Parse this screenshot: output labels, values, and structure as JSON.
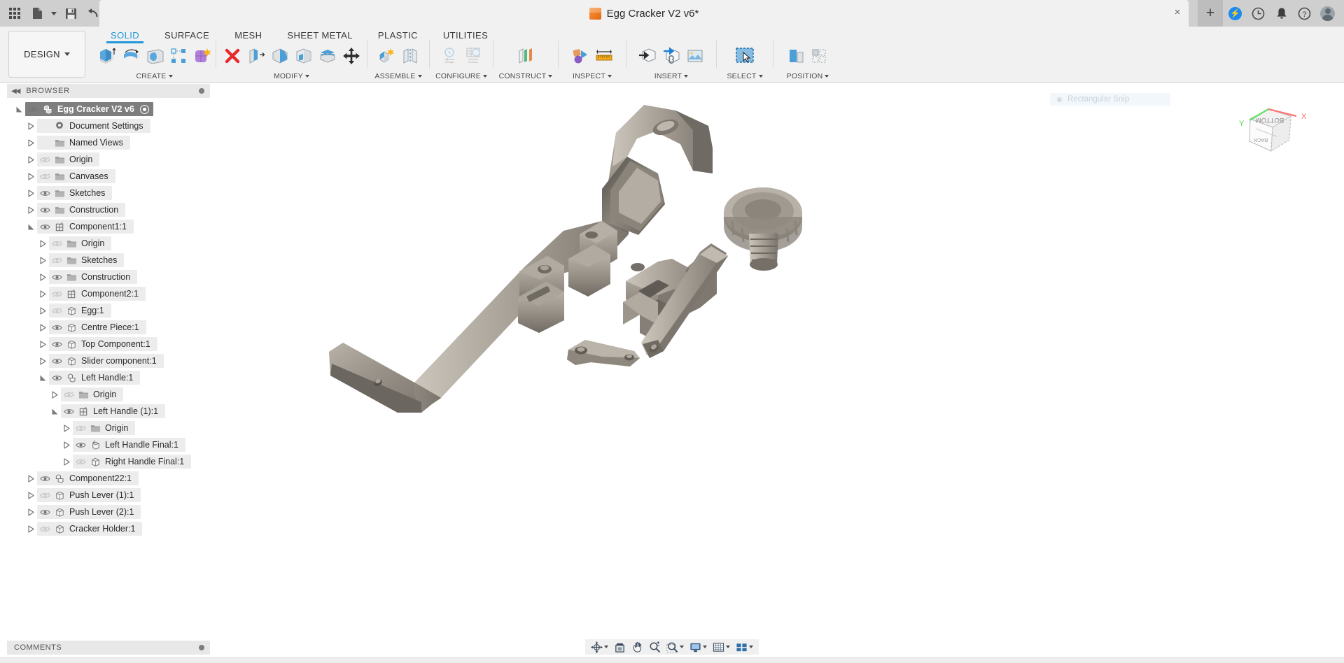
{
  "titlebar": {
    "document_title": "Egg Cracker V2 v6*",
    "doc_icon": "cube-icon",
    "apps_icon": "app-grid-icon",
    "new_icon": "new-document-icon",
    "save_icon": "save-icon",
    "undo_icon": "undo-icon",
    "redo_icon": "redo-icon",
    "close_tab": "×",
    "new_tab": "+",
    "right_icons": [
      "extension-icon",
      "job-status-icon",
      "notifications-icon",
      "help-icon",
      "account-avatar-icon"
    ]
  },
  "ribbon": {
    "workspace": "DESIGN",
    "tabs": [
      {
        "label": "SOLID",
        "active": true
      },
      {
        "label": "SURFACE",
        "active": false
      },
      {
        "label": "MESH",
        "active": false
      },
      {
        "label": "SHEET METAL",
        "active": false
      },
      {
        "label": "PLASTIC",
        "active": false
      },
      {
        "label": "UTILITIES",
        "active": false
      }
    ],
    "panels": [
      {
        "label": "CREATE",
        "commands": [
          "extrude-icon",
          "revolve-icon",
          "sphere-icon",
          "pattern-icon",
          "form-icon"
        ]
      },
      {
        "label": "MODIFY",
        "commands": [
          "delete-icon",
          "press-pull-icon",
          "fillet-icon",
          "shell-icon",
          "offset-face-icon",
          "move-copy-icon"
        ]
      },
      {
        "label": "ASSEMBLE",
        "commands": [
          "new-component-icon",
          "joint-icon"
        ]
      },
      {
        "label": "CONFIGURE",
        "commands": [
          "configuration-icon",
          "configuration-table-icon"
        ]
      },
      {
        "label": "CONSTRUCT",
        "commands": [
          "offset-plane-icon"
        ]
      },
      {
        "label": "INSPECT",
        "commands": [
          "section-analysis-icon",
          "measure-icon"
        ]
      },
      {
        "label": "INSERT",
        "commands": [
          "insert-derive-icon",
          "insert-mcmaster-icon",
          "insert-canvas-icon"
        ]
      },
      {
        "label": "SELECT",
        "commands": [
          "select-window-icon"
        ]
      },
      {
        "label": "POSITION",
        "commands": [
          "align-icon",
          "physical-material-icon"
        ]
      }
    ]
  },
  "browser": {
    "title": "BROWSER",
    "collapse_icon": "collapse-left-icon",
    "pin_icon": "panel-dot-icon",
    "tree": [
      {
        "label": "Egg Cracker V2 v6",
        "depth": 0,
        "state": "expanded",
        "eye": "visible",
        "icon": "document-icon",
        "root": true,
        "radio": true
      },
      {
        "label": "Document Settings",
        "depth": 1,
        "state": "collapsed",
        "eye": "none",
        "icon": "gear-icon"
      },
      {
        "label": "Named Views",
        "depth": 1,
        "state": "collapsed",
        "eye": "none",
        "icon": "folder-icon"
      },
      {
        "label": "Origin",
        "depth": 1,
        "state": "collapsed",
        "eye": "hidden",
        "icon": "folder-icon"
      },
      {
        "label": "Canvases",
        "depth": 1,
        "state": "collapsed",
        "eye": "hidden",
        "icon": "folder-icon"
      },
      {
        "label": "Sketches",
        "depth": 1,
        "state": "collapsed",
        "eye": "visible",
        "icon": "folder-icon"
      },
      {
        "label": "Construction",
        "depth": 1,
        "state": "collapsed",
        "eye": "visible",
        "icon": "folder-icon"
      },
      {
        "label": "Component1:1",
        "depth": 1,
        "state": "expanded",
        "eye": "visible",
        "icon": "component-icon"
      },
      {
        "label": "Origin",
        "depth": 2,
        "state": "collapsed",
        "eye": "hidden",
        "icon": "folder-icon"
      },
      {
        "label": "Sketches",
        "depth": 2,
        "state": "collapsed",
        "eye": "hidden",
        "icon": "folder-icon"
      },
      {
        "label": "Construction",
        "depth": 2,
        "state": "collapsed",
        "eye": "visible",
        "icon": "folder-icon"
      },
      {
        "label": "Component2:1",
        "depth": 2,
        "state": "collapsed",
        "eye": "hidden",
        "icon": "component-icon"
      },
      {
        "label": "Egg:1",
        "depth": 2,
        "state": "collapsed",
        "eye": "hidden",
        "icon": "body-icon"
      },
      {
        "label": "Centre Piece:1",
        "depth": 2,
        "state": "collapsed",
        "eye": "visible",
        "icon": "body-icon"
      },
      {
        "label": "Top Component:1",
        "depth": 2,
        "state": "collapsed",
        "eye": "visible",
        "icon": "body-icon"
      },
      {
        "label": "Slider component:1",
        "depth": 2,
        "state": "collapsed",
        "eye": "visible",
        "icon": "body-icon"
      },
      {
        "label": "Left Handle:1",
        "depth": 2,
        "state": "expanded",
        "eye": "visible",
        "icon": "document-icon"
      },
      {
        "label": "Origin",
        "depth": 3,
        "state": "collapsed",
        "eye": "hidden",
        "icon": "folder-icon"
      },
      {
        "label": "Left Handle (1):1",
        "depth": 3,
        "state": "expanded",
        "eye": "visible",
        "icon": "component-icon"
      },
      {
        "label": "Origin",
        "depth": 4,
        "state": "collapsed",
        "eye": "hidden",
        "icon": "folder-icon"
      },
      {
        "label": "Left Handle Final:1",
        "depth": 4,
        "state": "collapsed",
        "eye": "visible",
        "icon": "grounded-body-icon"
      },
      {
        "label": "Right Handle Final:1",
        "depth": 4,
        "state": "collapsed",
        "eye": "hidden",
        "icon": "body-icon"
      },
      {
        "label": "Component22:1",
        "depth": 1,
        "state": "collapsed",
        "eye": "visible",
        "icon": "document-icon"
      },
      {
        "label": "Push Lever (1):1",
        "depth": 1,
        "state": "collapsed",
        "eye": "hidden",
        "icon": "body-icon"
      },
      {
        "label": "Push Lever (2):1",
        "depth": 1,
        "state": "collapsed",
        "eye": "visible",
        "icon": "body-icon"
      },
      {
        "label": "Cracker Holder:1",
        "depth": 1,
        "state": "collapsed",
        "eye": "hidden",
        "icon": "body-icon"
      }
    ]
  },
  "canvas": {
    "snip_toast": "Rectangular Snip",
    "viewcube": {
      "top_face": "BOTTOM",
      "front_face": "BACK",
      "axis_x": "X",
      "axis_y": "Y"
    },
    "model_description": "Exploded 3D assembly of an egg cracker: long grey handle arm, cracker head, knurled thumbscrew, pivot pin, small link and centre block."
  },
  "comments": {
    "title": "COMMENTS",
    "pin_icon": "panel-dot-icon"
  },
  "navbar": {
    "items": [
      {
        "icon": "orbit-icon",
        "caret": true
      },
      {
        "icon": "look-at-icon",
        "caret": false
      },
      {
        "icon": "pan-icon",
        "caret": false
      },
      {
        "icon": "zoom-icon",
        "caret": false
      },
      {
        "icon": "zoom-window-icon",
        "caret": true
      },
      {
        "icon": "display-settings-icon",
        "caret": true
      },
      {
        "icon": "grid-settings-icon",
        "caret": true
      },
      {
        "icon": "viewports-icon",
        "caret": true
      }
    ]
  },
  "colors": {
    "accent": "#2196d8",
    "titlebar_bg": "#cfcfcf",
    "ribbon_bg": "#f1f1f1",
    "canvas_bg": "#ffffff",
    "tree_highlight": "#ececec",
    "root_highlight": "#7e7e7e",
    "axis_x": "#ff6b6b",
    "axis_y": "#5ddd5d",
    "model_grey": "#9b958c"
  }
}
